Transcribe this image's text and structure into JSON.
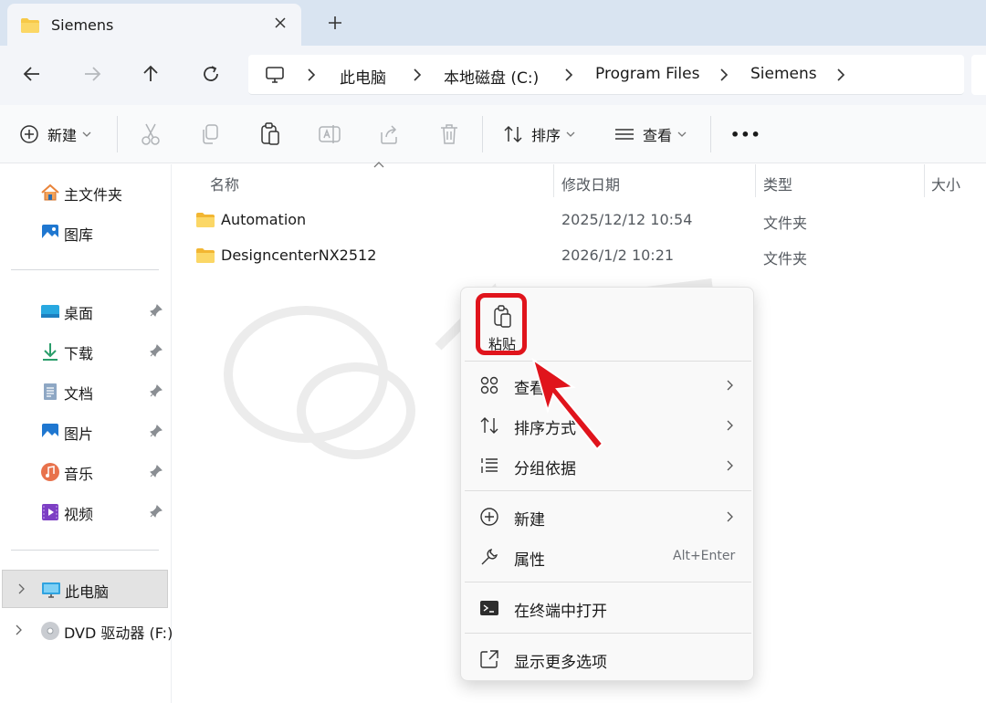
{
  "tab": {
    "title": "Siemens"
  },
  "breadcrumb": [
    "此电脑",
    "本地磁盘 (C:)",
    "Program Files",
    "Siemens"
  ],
  "toolbar": {
    "new_label": "新建",
    "sort_label": "排序",
    "view_label": "查看",
    "more_label": "•••"
  },
  "sidebar": {
    "quick": [
      {
        "label": "主文件夹",
        "icon": "home-icon"
      },
      {
        "label": "图库",
        "icon": "gallery-icon"
      }
    ],
    "pinned": [
      {
        "label": "桌面",
        "icon": "desktop-folder-icon"
      },
      {
        "label": "下载",
        "icon": "download-icon"
      },
      {
        "label": "文档",
        "icon": "document-icon"
      },
      {
        "label": "图片",
        "icon": "pictures-icon"
      },
      {
        "label": "音乐",
        "icon": "music-icon"
      },
      {
        "label": "视频",
        "icon": "video-icon"
      }
    ],
    "drives": [
      {
        "label": "此电脑",
        "icon": "computer-icon",
        "selected": true
      },
      {
        "label": "DVD 驱动器 (F:)",
        "icon": "dvd-drive-icon",
        "selected": false
      }
    ]
  },
  "columns": {
    "name": "名称",
    "date": "修改日期",
    "type": "类型",
    "size": "大小"
  },
  "files": [
    {
      "name": "Automation",
      "date": "2025/12/12 10:54",
      "type": "文件夹"
    },
    {
      "name": "DesigncenterNX2512",
      "date": "2026/1/2 10:21",
      "type": "文件夹"
    }
  ],
  "context_menu": {
    "paste_label": "粘贴",
    "items": [
      {
        "label": "查看",
        "icon": "grid-view-icon",
        "submenu": true
      },
      {
        "label": "排序方式",
        "icon": "sort-icon",
        "submenu": true
      },
      {
        "label": "分组依据",
        "icon": "group-by-icon",
        "submenu": true
      },
      {
        "label": "新建",
        "icon": "new-plus-icon",
        "submenu": true
      },
      {
        "label": "属性",
        "icon": "wrench-icon",
        "shortcut": "Alt+Enter"
      },
      {
        "label": "在终端中打开",
        "icon": "terminal-icon"
      },
      {
        "label": "显示更多选项",
        "icon": "more-options-icon"
      }
    ]
  },
  "colors": {
    "highlight_red": "#e0141c",
    "tab_strip": "#d9e4f1",
    "folder_yellow": "#f7c948"
  }
}
